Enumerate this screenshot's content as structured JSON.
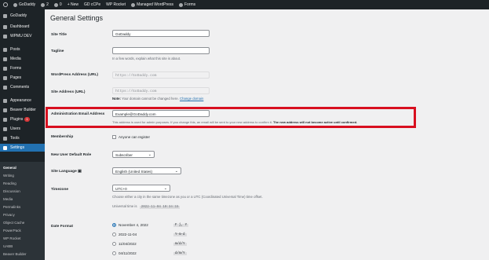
{
  "adminbar": {
    "site_name": "GoDaddy",
    "updates": "2",
    "comments": "0",
    "new_label": "New",
    "items": [
      "GD cCPe",
      "WP Rocket",
      "Managed WordPress",
      "Forms"
    ]
  },
  "sidebar": {
    "top_items": [
      {
        "label": "GoDaddy"
      },
      {
        "label": "Dashboard"
      },
      {
        "label": "WPMU DEV"
      },
      {
        "label": "Posts"
      },
      {
        "label": "Media"
      },
      {
        "label": "Forms"
      },
      {
        "label": "Pages"
      },
      {
        "label": "Comments"
      },
      {
        "label": "Appearance"
      },
      {
        "label": "Beaver Builder"
      },
      {
        "label": "Plugins",
        "badge": "1"
      },
      {
        "label": "Users"
      },
      {
        "label": "Tools"
      },
      {
        "label": "Settings"
      }
    ],
    "submenu": [
      "General",
      "Writing",
      "Reading",
      "Discussion",
      "Media",
      "Permalinks",
      "Privacy",
      "Object Cache",
      "PowerPack",
      "WP Rocket",
      "UABB",
      "Beaver Builder"
    ],
    "bottom_cut": "Yoast SEO"
  },
  "page": {
    "title": "General Settings",
    "site_title": {
      "label": "Site Title",
      "value": "GoDaddy"
    },
    "tagline": {
      "label": "Tagline",
      "value": "",
      "desc": "In a few words, explain what this site is about."
    },
    "wp_address": {
      "label": "WordPress Address (URL)",
      "value": "https://GoDaddy.com"
    },
    "site_address": {
      "label": "Site Address (URL)",
      "value": "https://GoDaddy.com",
      "note_bold": "Note:",
      "note": " Your domain cannot be changed here.",
      "link": "Change domain"
    },
    "admin_email": {
      "label": "Administration Email Address",
      "value": "Example@GoDaddy.com",
      "desc": "This address is used for admin purposes. If you change this, an email will be sent to your new address to confirm it. ",
      "desc_bold": "The new address will not become active until confirmed."
    },
    "membership": {
      "label": "Membership",
      "checkbox": "Anyone can register"
    },
    "default_role": {
      "label": "New User Default Role",
      "value": "Subscriber"
    },
    "site_language": {
      "label": "Site Language",
      "value": "English (United States)"
    },
    "timezone": {
      "label": "Timezone",
      "value": "UTC+0",
      "desc": "Choose either a city in the same timezone as you or a UTC (Coordinated Universal Time) time offset.",
      "universal_prefix": "Universal time is",
      "universal_time": "2022-11-04 10:34:15"
    },
    "date_format": {
      "label": "Date Format",
      "options": [
        {
          "label": "November 4, 2022",
          "code": "F j, Y",
          "checked": true
        },
        {
          "label": "2022-11-04",
          "code": "Y-m-d",
          "checked": false
        },
        {
          "label": "11/04/2022",
          "code": "m/d/Y",
          "checked": false
        },
        {
          "label": "04/11/2022",
          "code": "d/m/Y",
          "checked": false
        }
      ]
    }
  },
  "colors": {
    "adminbar": "#1d2327",
    "accent": "#2271b1",
    "highlight": "#d80f1f"
  }
}
